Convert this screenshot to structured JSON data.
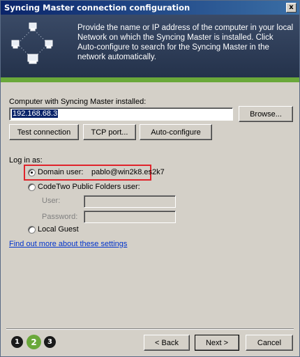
{
  "window": {
    "title": "Syncing Master connection configuration",
    "close_glyph": "x"
  },
  "banner": {
    "text": "Provide the name or IP address of the computer in your local Network on which the Syncing Master is installed. Click Auto-configure to search for the Syncing Master in the network automatically.",
    "icon": "network-computers-icon"
  },
  "computer": {
    "label": "Computer with Syncing Master installed:",
    "value": "192.168.68.3",
    "browse_label": "Browse..."
  },
  "actions": {
    "test_label": "Test connection",
    "tcp_label": "TCP port...",
    "auto_label": "Auto-configure"
  },
  "login": {
    "label": "Log in as:",
    "domain_label": "Domain user:",
    "domain_value": "pablo@win2k8.es2k7",
    "codetwo_label": "CodeTwo Public Folders user:",
    "user_label": "User:",
    "password_label": "Password:",
    "guest_label": "Local Guest",
    "selected": "domain"
  },
  "link": {
    "label": "Find out more about these settings"
  },
  "steps": [
    {
      "label": "1"
    },
    {
      "label": "2"
    },
    {
      "label": "3"
    }
  ],
  "footer": {
    "back_label": "< Back",
    "next_label": "Next >",
    "cancel_label": "Cancel"
  },
  "colors": {
    "accent_green": "#6aa83a",
    "highlight_red": "#e0232b",
    "link_blue": "#0033cc"
  }
}
